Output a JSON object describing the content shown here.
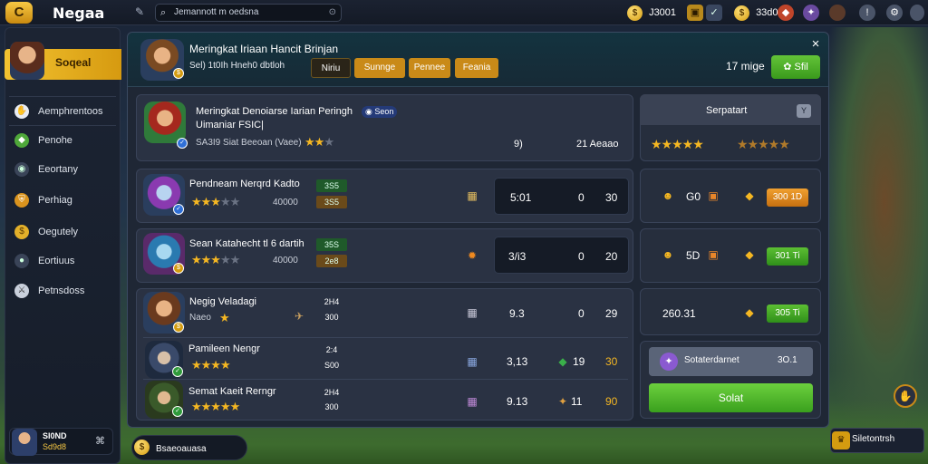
{
  "app": {
    "title": "Negaa",
    "logo_glyph": "C"
  },
  "search": {
    "value": "Jemannott m oedsna",
    "icon": "search-icon"
  },
  "currencies": [
    {
      "label": "J3001",
      "icon": "coin-icon"
    },
    {
      "label": "33d0",
      "icon": "coin-icon"
    }
  ],
  "sidebar": {
    "profile": {
      "name": "Soqeal"
    },
    "items": [
      {
        "label": "Aemphrentoos",
        "icon": "hand-icon"
      },
      {
        "label": "Penohe",
        "icon": "gem-icon"
      },
      {
        "label": "Eeortany",
        "icon": "circle-icon"
      },
      {
        "label": "Perhiag",
        "icon": "shield-icon"
      },
      {
        "label": "Oegutely",
        "icon": "coin-icon"
      },
      {
        "label": "Eortiuus",
        "icon": "orb-icon"
      },
      {
        "label": "Petnsdoss",
        "icon": "sword-icon"
      }
    ],
    "user": {
      "name": "SI0ND",
      "coins": "Sd9d8",
      "action_icon": "gamepad-icon"
    }
  },
  "header": {
    "title": "Meringkat Iriaan Hancit Brinjan",
    "stat": "Sel) 1t0Ih  Hneh0 dbtloh",
    "tabs": [
      "Niriu",
      "Sunnge",
      "Pennee",
      "Feania"
    ],
    "count": "17 mige",
    "action_label": "Sfil",
    "close": "×"
  },
  "featured": {
    "title": "Meringkat Denoiarse Iarian Peringh",
    "title_tag": "Seon",
    "subtitle": "Uimaniar FSIC|",
    "meta": "SA3I9 Siat Beeoan (Vaee)",
    "value_a": "9)",
    "value_b": "21 Aeaao"
  },
  "rows": [
    {
      "name": "Pendneam Nerqrd Kadto",
      "tag1": "3S5",
      "tag2": "3S5",
      "sub": "40000",
      "box_left": "5:01",
      "box_mid": "0",
      "box_right": "30",
      "stars": 3
    },
    {
      "name": "Sean Katahecht tl 6 dartih",
      "tag1": "35S",
      "tag2": "2e8",
      "sub": "40000",
      "box_left": "3/i3",
      "box_mid": "0",
      "box_right": "20",
      "stars": 3
    },
    {
      "name": "Negig Veladagi",
      "tag1": "2H4",
      "tag2": "300",
      "sub": "Naeo",
      "box_left": "9.3",
      "box_mid": "0",
      "box_right": "29",
      "stars": 1
    },
    {
      "name": "Pamileen Nengr",
      "tag1": "2:4",
      "tag2": "S00",
      "sub": "",
      "box_left": "3,13",
      "box_mid": "19",
      "box_right": "30",
      "stars": 4
    },
    {
      "name": "Semat Kaeit Rerngr",
      "tag1": "2H4",
      "tag2": "300",
      "sub": "",
      "box_left": "9.13",
      "box_mid": "11",
      "box_right": "90",
      "stars": 5
    }
  ],
  "right": {
    "filter_label": "Serpatart",
    "filter_key": "Y",
    "rating_label_a": "★★★★★",
    "rating_label_b": "★★★★★",
    "r1": {
      "a": "G0",
      "btn": "300 1D"
    },
    "r2": {
      "a": "5D",
      "btn": "301 Ti"
    },
    "r3": {
      "a": "260.31",
      "btn": "305 Ti"
    },
    "selector": {
      "label": "Sotaterdarnet",
      "value": "3O.1"
    },
    "confirm": "Solat"
  },
  "bottom": {
    "left_label": "Bsaeoauasa",
    "right_label": "Siletontrsh"
  },
  "colors": {
    "accent": "#f2c230",
    "green": "#4fb52c",
    "orange": "#e08a20",
    "panel": "#1f2735"
  }
}
